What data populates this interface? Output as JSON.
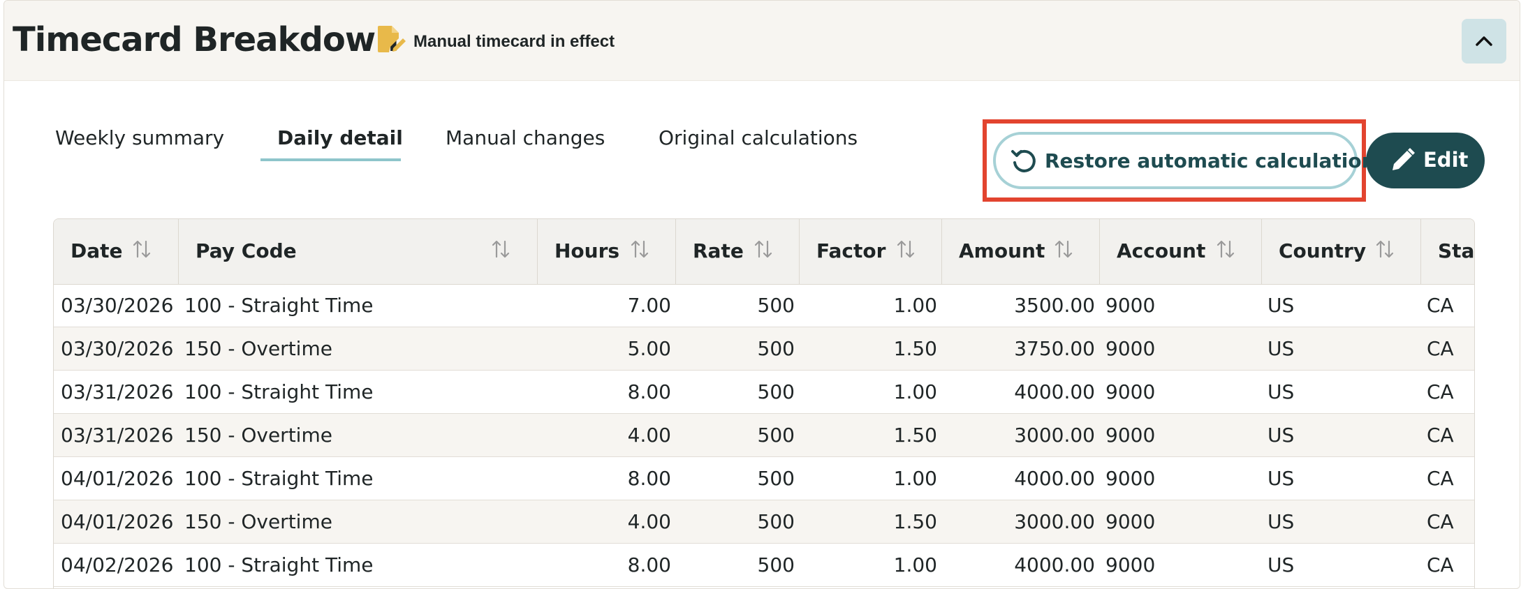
{
  "header": {
    "title": "Timecard Breakdown",
    "status_icon": "file-pen-icon",
    "status_text": "Manual timecard in effect",
    "collapse_icon": "chevron-up-icon"
  },
  "tabs": [
    {
      "label": "Weekly summary",
      "active": false
    },
    {
      "label": "Daily detail",
      "active": true
    },
    {
      "label": "Manual changes",
      "active": false
    },
    {
      "label": "Original calculations",
      "active": false
    }
  ],
  "actions": {
    "restore_label": "Restore automatic calculations",
    "restore_icon": "rotate-left-icon",
    "edit_label": "Edit",
    "edit_icon": "pencil-icon"
  },
  "table": {
    "columns": [
      "Date",
      "Pay Code",
      "Hours",
      "Rate",
      "Factor",
      "Amount",
      "Account",
      "Country",
      "Stat"
    ],
    "rows": [
      [
        "03/30/2026",
        "100 - Straight Time",
        "7.00",
        "500",
        "1.00",
        "3500.00",
        "9000",
        "US",
        "CA"
      ],
      [
        "03/30/2026",
        "150 - Overtime",
        "5.00",
        "500",
        "1.50",
        "3750.00",
        "9000",
        "US",
        "CA"
      ],
      [
        "03/31/2026",
        "100 - Straight Time",
        "8.00",
        "500",
        "1.00",
        "4000.00",
        "9000",
        "US",
        "CA"
      ],
      [
        "03/31/2026",
        "150 - Overtime",
        "4.00",
        "500",
        "1.50",
        "3000.00",
        "9000",
        "US",
        "CA"
      ],
      [
        "04/01/2026",
        "100 - Straight Time",
        "8.00",
        "500",
        "1.00",
        "4000.00",
        "9000",
        "US",
        "CA"
      ],
      [
        "04/01/2026",
        "150 - Overtime",
        "4.00",
        "500",
        "1.50",
        "3000.00",
        "9000",
        "US",
        "CA"
      ],
      [
        "04/02/2026",
        "100 - Straight Time",
        "8.00",
        "500",
        "1.00",
        "4000.00",
        "9000",
        "US",
        "CA"
      ]
    ]
  },
  "colors": {
    "accent": "#1e4b50",
    "tab_underline": "#8ec5cb",
    "highlight": "#e2442f",
    "header_bg": "#f7f5f1"
  }
}
